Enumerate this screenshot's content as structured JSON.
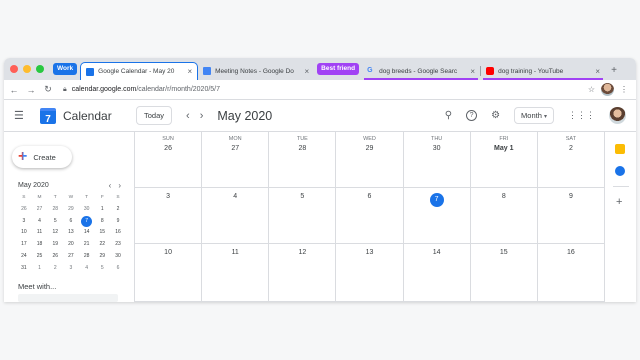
{
  "browser": {
    "tab_groups": [
      {
        "label": "Work",
        "color": "#1a73e8"
      },
      {
        "label": "Best friend",
        "color": "#a142f4"
      }
    ],
    "tabs": [
      {
        "title": "Google Calendar - May 20",
        "favicon": "calendar-favicon",
        "active": true
      },
      {
        "title": "Meeting Notes - Google Do",
        "favicon": "docs-favicon"
      },
      {
        "title": "dog breeds - Google Searc",
        "favicon": "google-favicon"
      },
      {
        "title": "dog training - YouTube",
        "favicon": "youtube-favicon"
      }
    ],
    "url_host": "calendar.google.com",
    "url_path": "/calendar/r/month/2020/5/7"
  },
  "app": {
    "name": "Calendar",
    "logo_text": "7",
    "today_label": "Today",
    "period": "May 2020",
    "view_label": "Month",
    "create_label": "Create"
  },
  "mini_calendar": {
    "title": "May 2020",
    "weekdays": [
      "S",
      "M",
      "T",
      "W",
      "T",
      "F",
      "S"
    ],
    "weeks": [
      [
        "26",
        "27",
        "28",
        "29",
        "30",
        "1",
        "2"
      ],
      [
        "3",
        "4",
        "5",
        "6",
        "7",
        "8",
        "9"
      ],
      [
        "10",
        "11",
        "12",
        "13",
        "14",
        "15",
        "16"
      ],
      [
        "17",
        "18",
        "19",
        "20",
        "21",
        "22",
        "23"
      ],
      [
        "24",
        "25",
        "26",
        "27",
        "28",
        "29",
        "30"
      ],
      [
        "31",
        "1",
        "2",
        "3",
        "4",
        "5",
        "6"
      ]
    ],
    "today": "7"
  },
  "meet_label": "Meet with...",
  "month_grid": {
    "weekdays": [
      "SUN",
      "MON",
      "TUE",
      "WED",
      "THU",
      "FRI",
      "SAT"
    ],
    "week1": [
      "26",
      "27",
      "28",
      "29",
      "30",
      "May 1",
      "2"
    ],
    "week2": [
      "3",
      "4",
      "5",
      "6",
      "7",
      "8",
      "9"
    ],
    "week3": [
      "10",
      "11",
      "12",
      "13",
      "14",
      "15",
      "16"
    ],
    "today": "7"
  },
  "colors": {
    "accent": "#1a73e8",
    "work_group": "#1a73e8",
    "friend_group": "#a142f4"
  }
}
